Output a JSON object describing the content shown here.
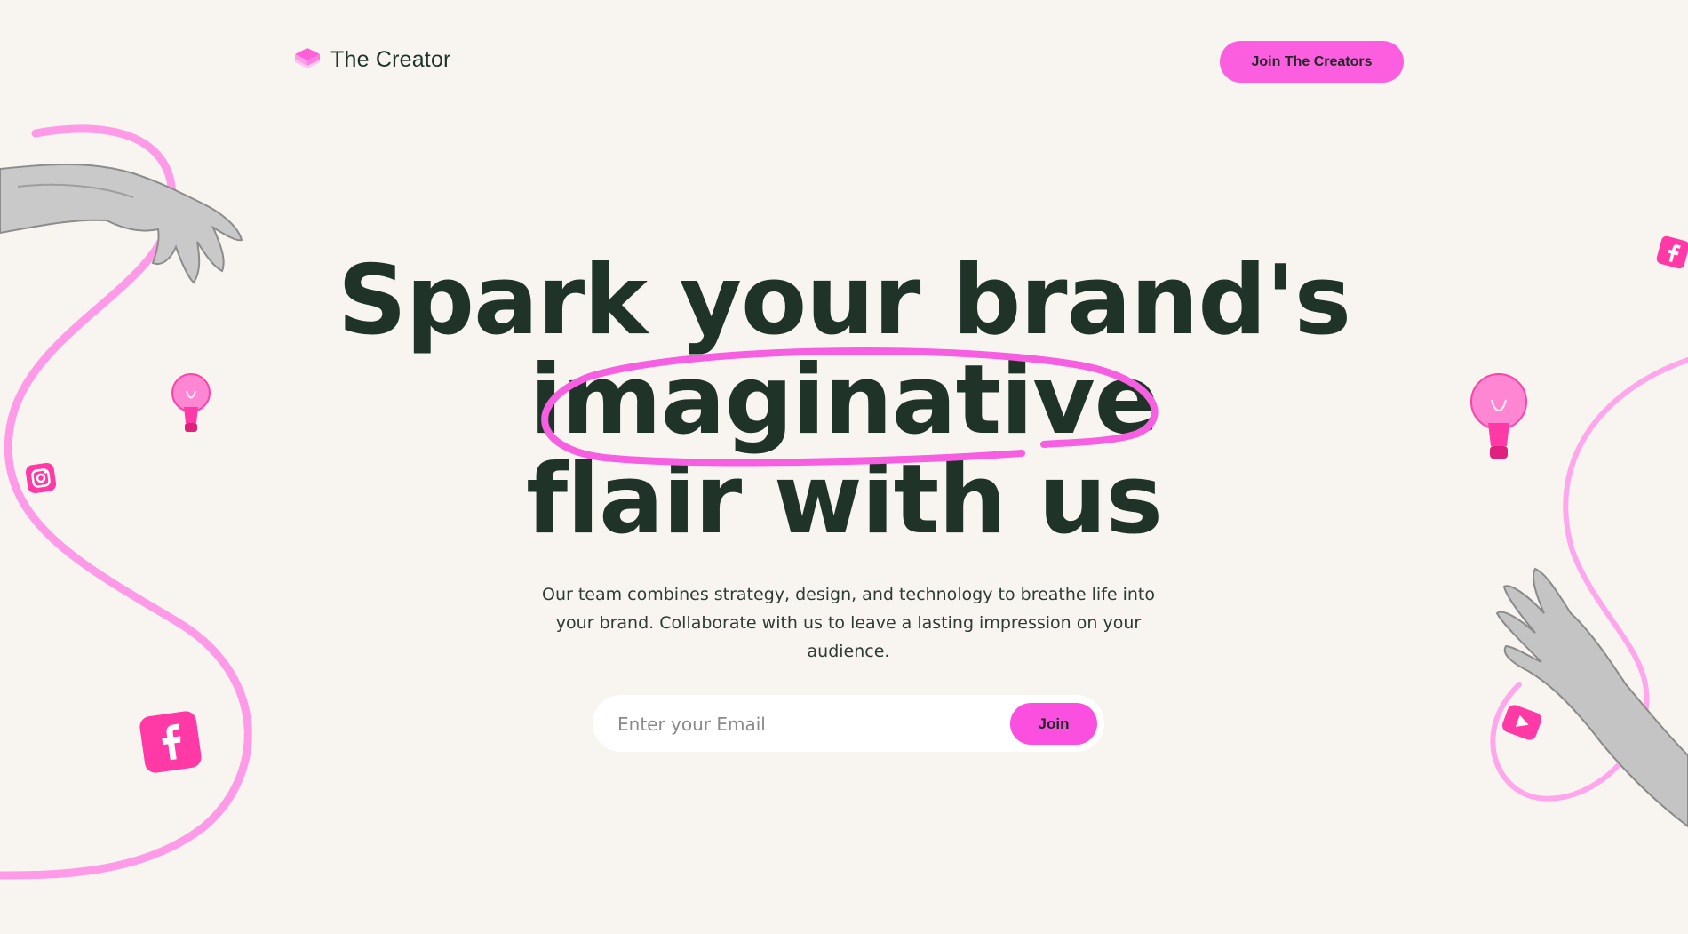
{
  "header": {
    "brand_name": "The Creator",
    "cta_label": "Join The Creators"
  },
  "hero": {
    "title_line_1": "Spark your brand's",
    "title_line_2": "imaginative",
    "title_line_3": "flair with us",
    "subtitle": "Our team combines strategy, design, and technology to breathe life into your brand. Collaborate with us to leave a lasting impression on your audience."
  },
  "signup": {
    "email_placeholder": "Enter your Email",
    "email_value": "",
    "join_label": "Join"
  },
  "colors": {
    "background": "#f8f5f1",
    "accent_pink": "#fb5fe0",
    "text_dark_green": "#1f3329"
  },
  "icons": [
    "logo-cube-icon",
    "hand-left-image",
    "hand-right-image",
    "lightbulb-icon",
    "instagram-icon",
    "facebook-icon",
    "youtube-icon"
  ]
}
